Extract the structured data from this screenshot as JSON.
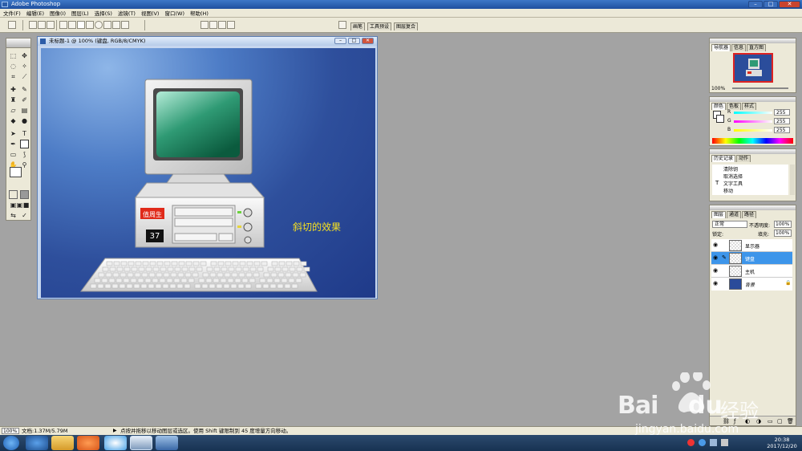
{
  "window": {
    "title": "Adobe Photoshop"
  },
  "menu": [
    "文件(F)",
    "编辑(E)",
    "图像(I)",
    "图层(L)",
    "选择(S)",
    "滤镜(T)",
    "视图(V)",
    "窗口(W)",
    "帮助(H)"
  ],
  "palette_tabs": [
    "画笔",
    "工具预设",
    "图层复合"
  ],
  "document": {
    "title": "未标题-1 @ 100% (键盘, RGB/8/CMYK)",
    "caption": "斜切的效果",
    "computer_badge": "值周生",
    "computer_number": "37"
  },
  "navigator": {
    "tabs": [
      "导航器",
      "信息",
      "直方图"
    ],
    "zoom": "100%"
  },
  "color": {
    "tabs": [
      "颜色",
      "色板",
      "样式"
    ],
    "channels": [
      {
        "label": "R",
        "value": "255"
      },
      {
        "label": "G",
        "value": "255"
      },
      {
        "label": "B",
        "value": "255"
      }
    ]
  },
  "history": {
    "tabs": [
      "历史记录",
      "动作"
    ],
    "items": [
      "清除钥",
      "取消选择",
      "文字工具",
      "移动"
    ]
  },
  "layers": {
    "tabs": [
      "图层",
      "通道",
      "路径"
    ],
    "blend_mode": "正常",
    "opacity_label": "不透明度:",
    "opacity": "100%",
    "lock_label": "锁定:",
    "fill_label": "填充:",
    "fill": "100%",
    "items": [
      "显示器",
      "键盘",
      "主机",
      "背景"
    ],
    "selected": "键盘"
  },
  "status": {
    "zoom": "100%",
    "doc_size": "文档:1.37M/5.79M",
    "hint": "点按并拖移以移动图层或选区。使用 Shift 键限制到 45 度增量方向移动。"
  },
  "taskbar": {
    "time": "20:38",
    "date": "2017/12/20"
  },
  "watermark": {
    "brand": "Bai",
    "brand2": "du",
    "cn": "经验",
    "url": "jingyan.baidu.com"
  }
}
